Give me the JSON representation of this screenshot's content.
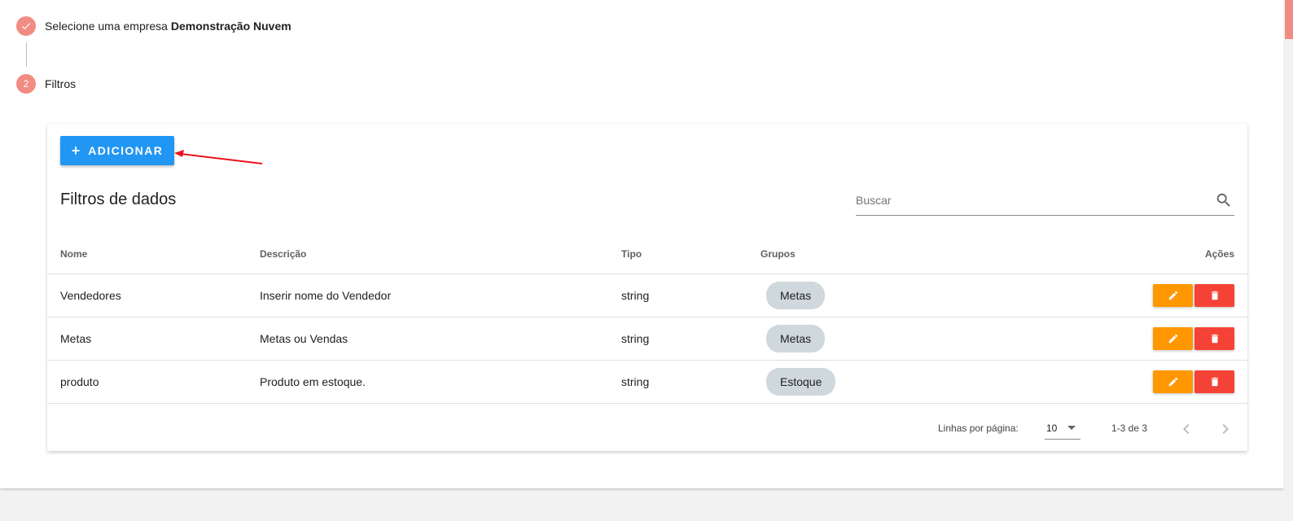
{
  "stepper": {
    "step1": {
      "label": "Selecione uma empresa",
      "company": "Demonstração Nuvem",
      "state": "completed"
    },
    "step2": {
      "number": "2",
      "label": "Filtros",
      "state": "active"
    }
  },
  "card": {
    "add_button_label": "ADICIONAR",
    "title": "Filtros de dados",
    "search": {
      "placeholder": "Buscar",
      "value": ""
    },
    "table": {
      "headers": {
        "nome": "Nome",
        "descricao": "Descrição",
        "tipo": "Tipo",
        "grupos": "Grupos",
        "acoes": "Ações"
      },
      "rows": [
        {
          "nome": "Vendedores",
          "descricao": "Inserir nome do Vendedor",
          "tipo": "string",
          "grupo": "Metas"
        },
        {
          "nome": "Metas",
          "descricao": "Metas ou Vendas",
          "tipo": "string",
          "grupo": "Metas"
        },
        {
          "nome": "produto",
          "descricao": "Produto em estoque.",
          "tipo": "string",
          "grupo": "Estoque"
        }
      ]
    },
    "footer": {
      "rows_per_page_label": "Linhas por página:",
      "rows_per_page_value": "10",
      "range": "1-3 de 3"
    }
  },
  "icons": {
    "check": "check-icon",
    "add": "plus-icon",
    "search": "search-icon",
    "edit": "pencil-icon",
    "delete": "trash-icon",
    "prev": "chevron-left-icon",
    "next": "chevron-right-icon",
    "dropdown": "caret-down-icon"
  },
  "colors": {
    "step": "#f28b82",
    "primary": "#2196f3",
    "edit": "#ff9800",
    "delete": "#f44336",
    "chip": "#cfd8dc",
    "annotation_arrow": "#e8141c"
  }
}
